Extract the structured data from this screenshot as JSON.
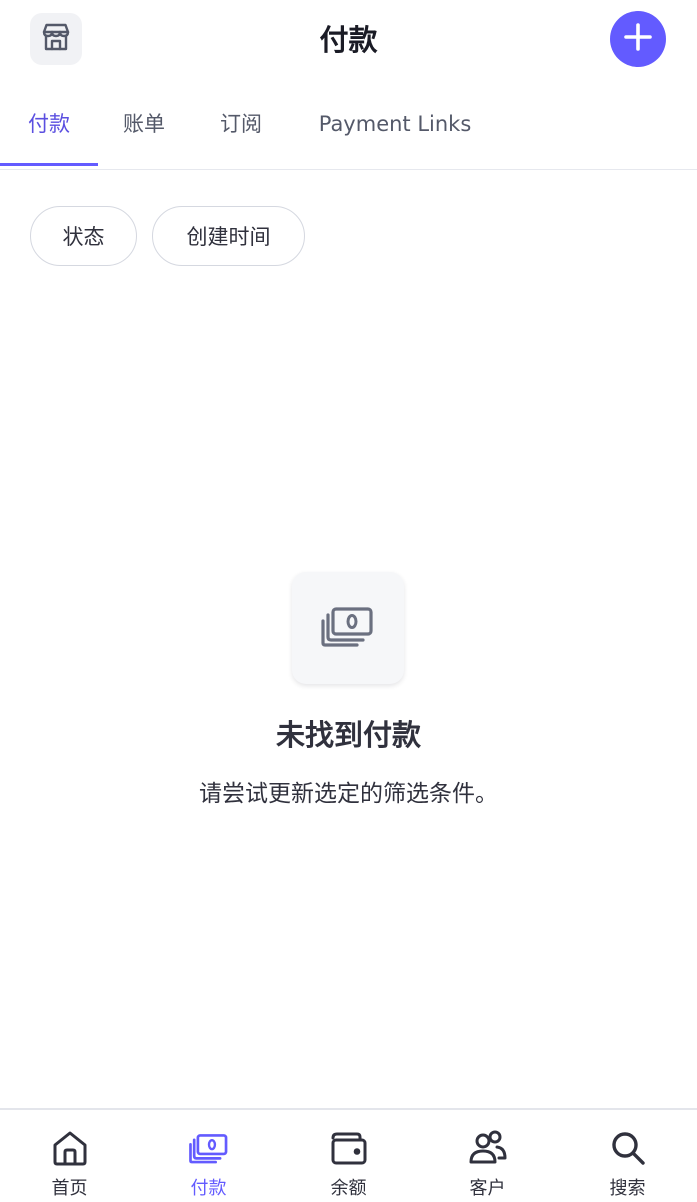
{
  "header": {
    "title": "付款",
    "store_icon": "store-icon",
    "add_icon": "plus-icon"
  },
  "tabs": [
    {
      "label": "付款",
      "active": true
    },
    {
      "label": "账单",
      "active": false
    },
    {
      "label": "订阅",
      "active": false
    },
    {
      "label": "Payment Links",
      "active": false
    }
  ],
  "filters": [
    {
      "label": "状态"
    },
    {
      "label": "创建时间"
    }
  ],
  "empty_state": {
    "icon": "cash-icon",
    "title": "未找到付款",
    "subtitle": "请尝试更新选定的筛选条件。"
  },
  "bottom_nav": [
    {
      "label": "首页",
      "icon": "home-icon",
      "active": false
    },
    {
      "label": "付款",
      "icon": "cash-icon",
      "active": true
    },
    {
      "label": "余额",
      "icon": "wallet-icon",
      "active": false
    },
    {
      "label": "客户",
      "icon": "people-icon",
      "active": false
    },
    {
      "label": "搜索",
      "icon": "search-icon",
      "active": false
    }
  ],
  "colors": {
    "accent": "#635bff",
    "text": "#30313d",
    "muted": "#545969"
  }
}
